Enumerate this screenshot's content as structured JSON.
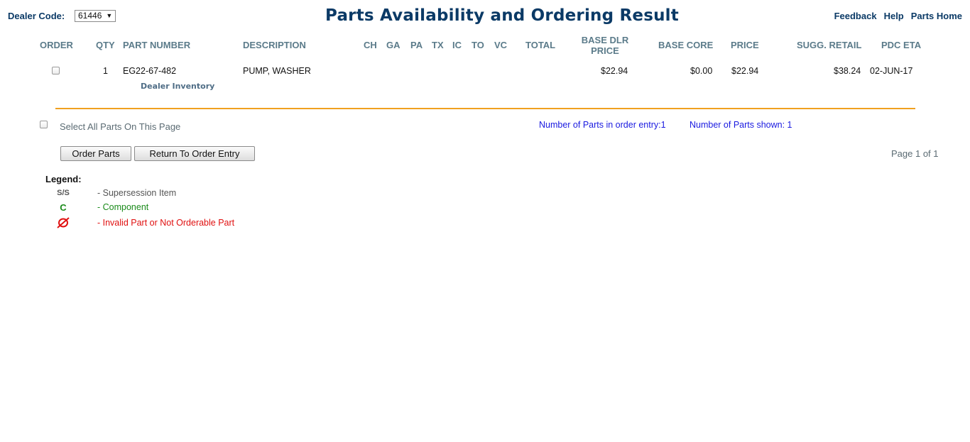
{
  "header": {
    "dealer_label": "Dealer Code:",
    "dealer_code": "61446",
    "title": "Parts Availability and Ordering Result",
    "links": [
      "Feedback",
      "Help",
      "Parts Home"
    ]
  },
  "table": {
    "columns": {
      "order": "ORDER",
      "qty": "QTY",
      "part_number": "PART NUMBER",
      "description": "DESCRIPTION",
      "ch": "CH",
      "ga": "GA",
      "pa": "PA",
      "tx": "TX",
      "ic": "IC",
      "to": "TO",
      "vc": "VC",
      "total": "TOTAL",
      "base_dlr_price_1": "BASE DLR",
      "base_dlr_price_2": "PRICE",
      "base_core": "BASE CORE",
      "price": "PRICE",
      "sugg_retail": "SUGG. RETAIL",
      "pdc_eta": "PDC ETA"
    },
    "rows": [
      {
        "qty": "1",
        "part_number": "EG22-67-482",
        "sub_link": "Dealer Inventory",
        "description": "PUMP, WASHER",
        "base_dlr_price": "$22.94",
        "base_core": "$0.00",
        "price": "$22.94",
        "sugg_retail": "$38.24",
        "pdc_eta": "02-JUN-17"
      }
    ]
  },
  "footer": {
    "select_all_label": "Select All Parts On This Page",
    "parts_in_entry": "Number of Parts in order entry:1",
    "parts_shown": "Number of Parts shown: 1",
    "order_button": "Order Parts",
    "return_button": "Return To Order Entry",
    "page_info": "Page 1 of 1"
  },
  "legend": {
    "title": "Legend:",
    "items": [
      {
        "symbol": "S/S",
        "desc": "- Supersession Item",
        "color": "#555555"
      },
      {
        "symbol": "C",
        "desc": "- Component",
        "color": "#1a8a1a"
      },
      {
        "symbol": "invalid-icon",
        "desc": "- Invalid Part or Not Orderable Part",
        "color": "#e01010"
      }
    ]
  }
}
